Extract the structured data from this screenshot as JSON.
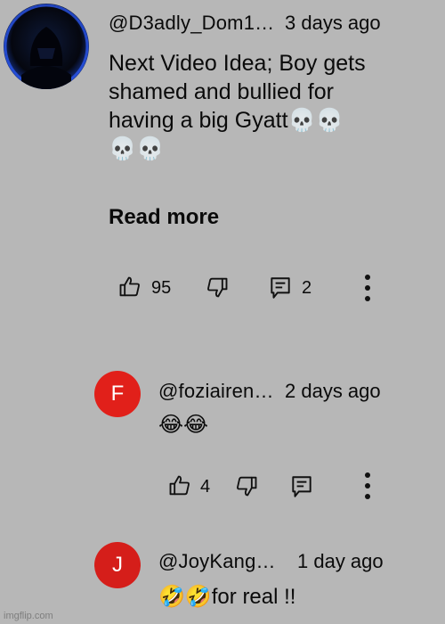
{
  "comments": [
    {
      "handle": "@D3adly_Dom1…",
      "time": "3 days ago",
      "text_lines": [
        "Next Video Idea; Boy gets",
        "shamed and bullied for",
        "having a big Gyatt💀💀",
        "💀💀"
      ],
      "read_more": "Read more",
      "likes": "95",
      "replies": "2"
    }
  ],
  "replies": [
    {
      "avatar_letter": "F",
      "avatar_color": "#e1201a",
      "handle": "@foziairen…",
      "time": "2 days ago",
      "text": "😂😂",
      "likes": "4"
    },
    {
      "avatar_letter": "J",
      "avatar_color": "#d51e1a",
      "handle": "@JoyKang…",
      "time": "1 day ago",
      "text": "🤣🤣for real !!"
    }
  ],
  "icons": {
    "like": "thumbs-up-icon",
    "dislike": "thumbs-down-icon",
    "reply": "comment-icon",
    "more": "more-vertical-icon"
  },
  "watermark": "imgflip.com"
}
